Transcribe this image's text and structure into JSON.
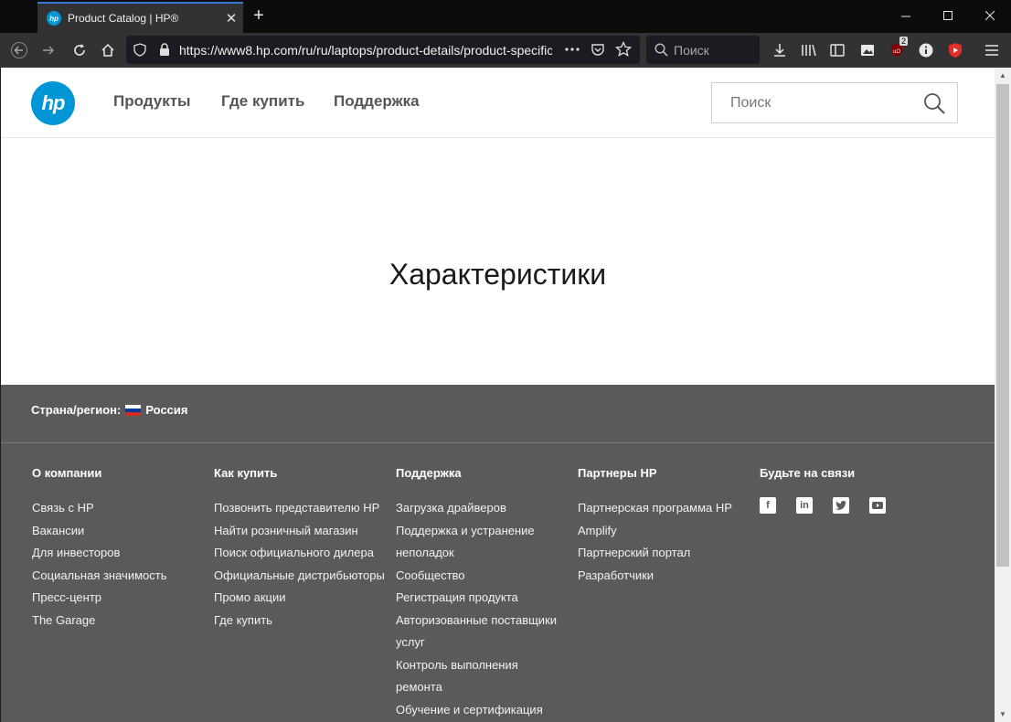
{
  "browser": {
    "tab_title": "Product Catalog | HP®",
    "new_tab": "+",
    "tab_close": "✕",
    "url": "https://www8.hp.com/ru/ru/laptops/product-details/product-specific",
    "search_placeholder": "Поиск",
    "ublock_badge": "2",
    "favicon_text": "hp"
  },
  "header": {
    "logo_text": "hp",
    "nav": [
      "Продукты",
      "Где купить",
      "Поддержка"
    ],
    "search_placeholder": "Поиск"
  },
  "main": {
    "heading": "Характеристики"
  },
  "footer": {
    "country_label": "Страна/регион:",
    "country_value": "Россия",
    "columns": [
      {
        "title": "О компании",
        "links": [
          "Связь с HP",
          "Вакансии",
          "Для инвесторов",
          "Социальная значимость",
          "Пресс-центр",
          "The Garage"
        ]
      },
      {
        "title": "Как купить",
        "links": [
          "Позвонить представителю HP",
          "Найти розничный магазин",
          "Поиск официального дилера",
          "Официальные дистрибьюторы",
          "Промо акции",
          "Где купить"
        ]
      },
      {
        "title": "Поддержка",
        "links": [
          "Загрузка драйверов",
          "Поддержка и устранение",
          "неполадок",
          "Сообщество",
          "Регистрация продукта",
          "Авторизованные поставщики",
          "услуг",
          "Контроль выполнения",
          "ремонта",
          "Обучение и сертификация"
        ]
      },
      {
        "title": "Партнеры HP",
        "links": [
          "Партнерская программа HP",
          "Amplify",
          "Партнерский портал",
          "Разработчики"
        ]
      },
      {
        "title": "Будьте на связи",
        "social": [
          "facebook-icon",
          "linkedin-icon",
          "twitter-icon",
          "youtube-icon"
        ]
      }
    ]
  },
  "colors": {
    "hp_blue": "#0096d6",
    "footer_bg": "#5a5a5a",
    "browser_dark": "#0c0c0d",
    "toolbar": "#323234"
  }
}
